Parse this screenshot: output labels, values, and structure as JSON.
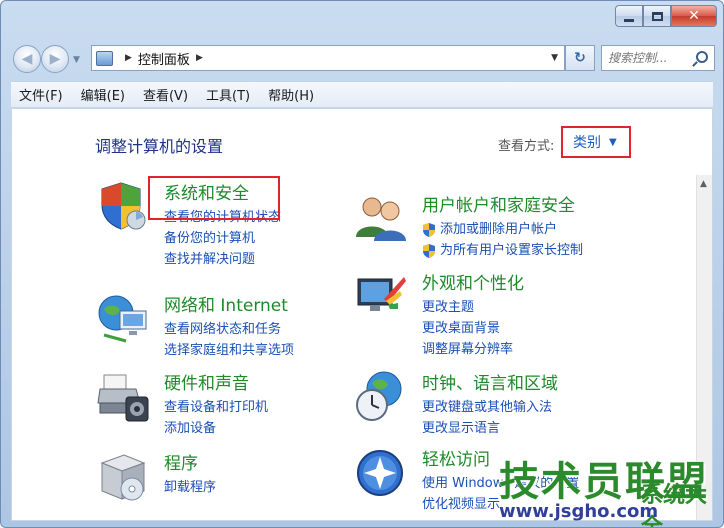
{
  "breadcrumb": {
    "root_label": "控制面板"
  },
  "search": {
    "placeholder": "搜索控制..."
  },
  "menu": {
    "items": [
      "文件(F)",
      "编辑(E)",
      "查看(V)",
      "工具(T)",
      "帮助(H)"
    ]
  },
  "page": {
    "title": "调整计算机的设置",
    "view_label": "查看方式:",
    "view_value": "类别"
  },
  "categories": [
    {
      "title": "系统和安全",
      "links": [
        "查看您的计算机状态",
        "备份您的计算机",
        "查找并解决问题"
      ]
    },
    {
      "title": "网络和 Internet",
      "links": [
        "查看网络状态和任务",
        "选择家庭组和共享选项"
      ]
    },
    {
      "title": "硬件和声音",
      "links": [
        "查看设备和打印机",
        "添加设备"
      ]
    },
    {
      "title": "程序",
      "links": [
        "卸载程序"
      ]
    },
    {
      "title": "用户帐户和家庭安全",
      "links": [
        "添加或删除用户帐户",
        "为所有用户设置家长控制"
      ]
    },
    {
      "title": "外观和个性化",
      "links": [
        "更改主题",
        "更改桌面背景",
        "调整屏幕分辨率"
      ]
    },
    {
      "title": "时钟、语言和区域",
      "links": [
        "更改键盘或其他输入法",
        "更改显示语言"
      ]
    },
    {
      "title": "轻松访问",
      "links": [
        "使用 Windows 建议的设置",
        "优化视频显示"
      ]
    }
  ],
  "watermark": {
    "main": "技术员联盟",
    "side": "系统大全",
    "sub": "www.jsgho.com"
  },
  "colors": {
    "accent": "#1a4fb4",
    "category_green": "#1e8a2a",
    "highlight_red": "#e0242d",
    "title_blue": "#1e3287"
  }
}
